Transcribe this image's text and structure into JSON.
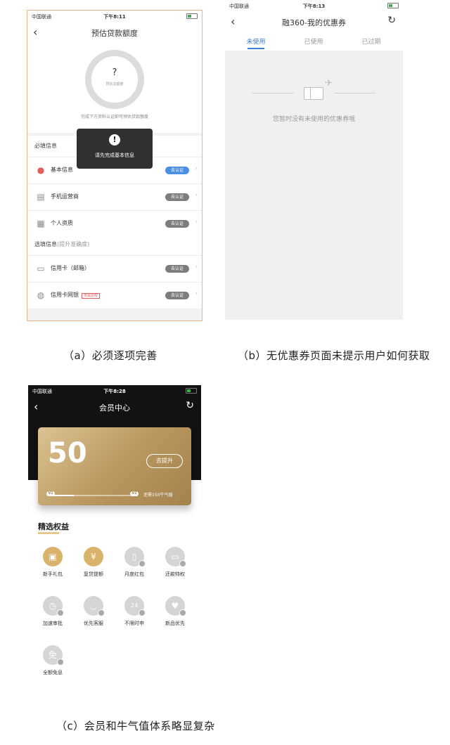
{
  "phone_a": {
    "status": {
      "carrier": "中国联通",
      "time": "下午8:11"
    },
    "title": "预估贷款额度",
    "ring_symbol": "?",
    "ring_label": "预估总额度",
    "hint": "完成下方资料认证即可预估贷款额度",
    "required_header": "必填信息",
    "required_rows": [
      {
        "label": "基本信息",
        "icon": "user-icon",
        "action": "去认证"
      },
      {
        "label": "手机运营商",
        "icon": "phone-icon",
        "action": "去认证"
      },
      {
        "label": "个人资质",
        "icon": "document-icon",
        "action": "去认证"
      }
    ],
    "optional_header": "选填信息",
    "optional_sub": "(提升准确度)",
    "optional_rows": [
      {
        "label": "信用卡（邮箱）",
        "icon": "credit-card-icon",
        "action": "去认证",
        "tag": ""
      },
      {
        "label": "信用卡网银",
        "icon": "bank-icon",
        "action": "去认证",
        "tag": "专属授权"
      }
    ],
    "toast": {
      "symbol": "!",
      "message": "请先完成基本信息"
    }
  },
  "phone_b": {
    "status": {
      "carrier": "中国联通",
      "time": "下午8:13"
    },
    "title": "融360-我的优惠券",
    "tabs": [
      "未使用",
      "已使用",
      "已过期"
    ],
    "empty_text": "您暂时没有未使用的优惠券哦"
  },
  "phone_c": {
    "status": {
      "carrier": "中国联通",
      "time": "下午8:28"
    },
    "title": "会员中心",
    "score": "50",
    "upgrade_button": "去提升",
    "level_from": "V1",
    "level_to": "V2",
    "need_text": "还需150牛气值",
    "progress_fraction": 0.28,
    "benefits_title": "精选权益",
    "benefits": [
      {
        "label": "新手礼包",
        "icon": "gift-icon",
        "active": true
      },
      {
        "label": "复贷提额",
        "icon": "money-bag-icon",
        "active": true
      },
      {
        "label": "月度红包",
        "icon": "red-packet-icon",
        "active": false
      },
      {
        "label": "还款特权",
        "icon": "card-icon",
        "active": false
      },
      {
        "label": "加速审批",
        "icon": "clock-icon",
        "active": false
      },
      {
        "label": "优先客服",
        "icon": "chat-icon",
        "active": false
      },
      {
        "label": "不限时申",
        "icon": "24h-icon",
        "active": false
      },
      {
        "label": "新品优先",
        "icon": "heart-icon",
        "active": false
      },
      {
        "label": "全额免息",
        "icon": "ticket-icon",
        "active": false
      }
    ]
  },
  "captions": {
    "a": "（a）必须逐项完善",
    "b": "（b）无优惠券页面未提示用户如何获取",
    "c": "（c）会员和牛气值体系略显复杂"
  },
  "colors": {
    "accent_blue": "#3a7fd5",
    "gold": "#d9b26c",
    "toast_bg": "#1e1e1e"
  }
}
